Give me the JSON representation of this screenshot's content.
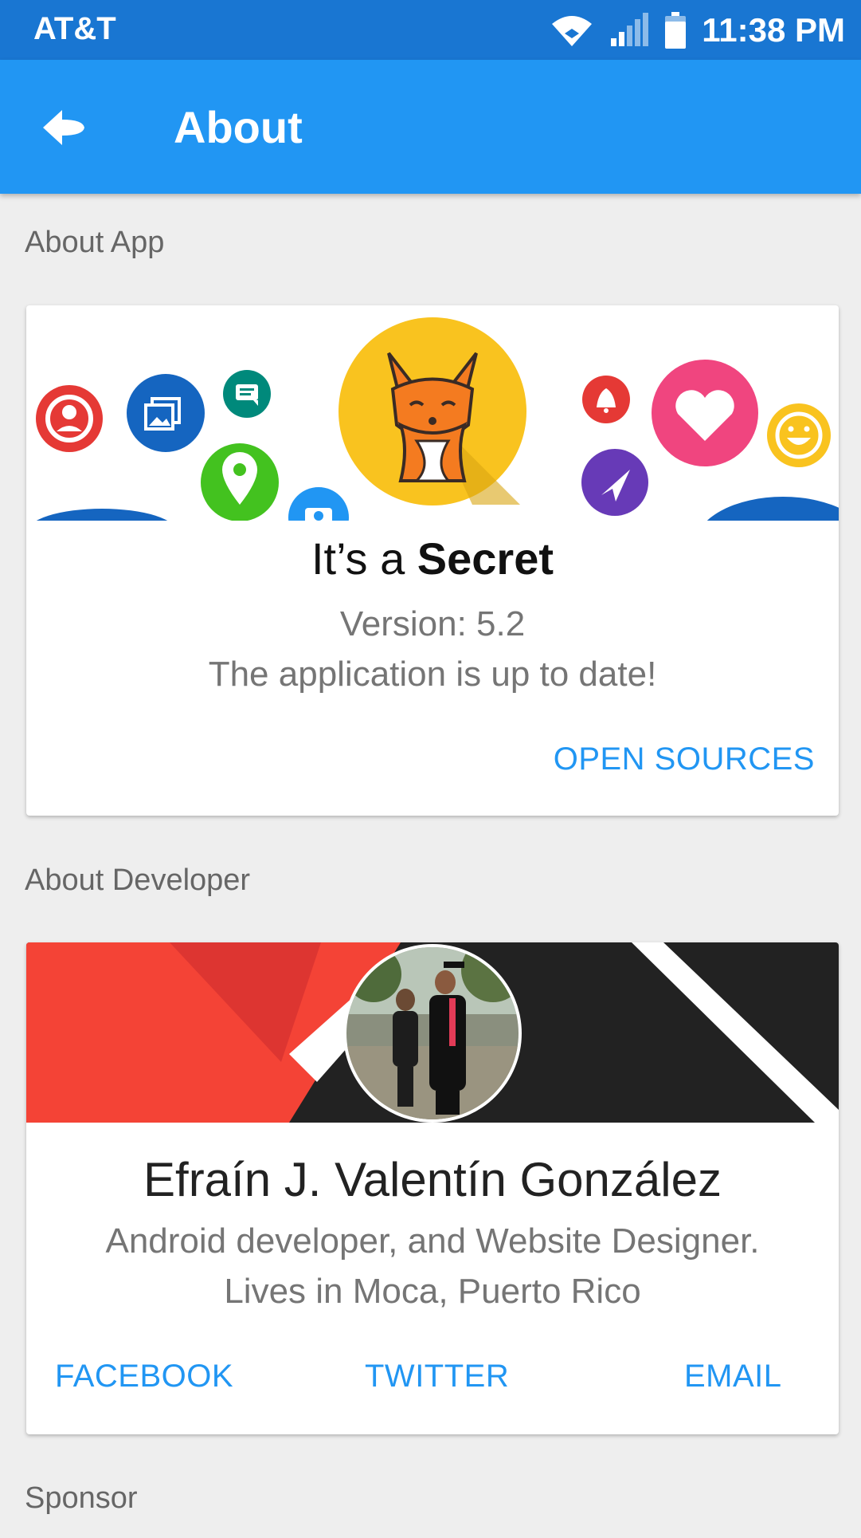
{
  "status_bar": {
    "carrier": "AT&T",
    "time": "11:38 PM",
    "icons": [
      "wifi-icon",
      "signal-icon",
      "battery-icon"
    ]
  },
  "app_bar": {
    "title": "About",
    "back_icon": "arrow-back-icon"
  },
  "sections": {
    "about_app": "About App",
    "about_developer": "About Developer",
    "sponsor": "Sponsor"
  },
  "app_card": {
    "name_prefix": "It’s a ",
    "name_bold": "Secret",
    "version": "Version: 5.2",
    "status": "The application is up to date!",
    "open_sources_label": "OPEN SOURCES",
    "banner_icons": [
      "profile-icon",
      "gallery-icon",
      "chat-icon",
      "location-pin-icon",
      "camera-icon",
      "fox-logo-icon",
      "bell-icon",
      "heart-icon",
      "smile-icon",
      "send-icon"
    ]
  },
  "developer_card": {
    "name": "Efraín J. Valentín González",
    "bio_line1": "Android developer, and Website Designer.",
    "bio_line2": "Lives in Moca, Puerto Rico",
    "facebook_label": "FACEBOOK",
    "twitter_label": "TWITTER",
    "email_label": "EMAIL"
  },
  "colors": {
    "status_bar": "#1976d2",
    "app_bar": "#2196f3",
    "accent": "#2196f3",
    "banner_red": "#f44336",
    "banner_dark": "#222222"
  }
}
